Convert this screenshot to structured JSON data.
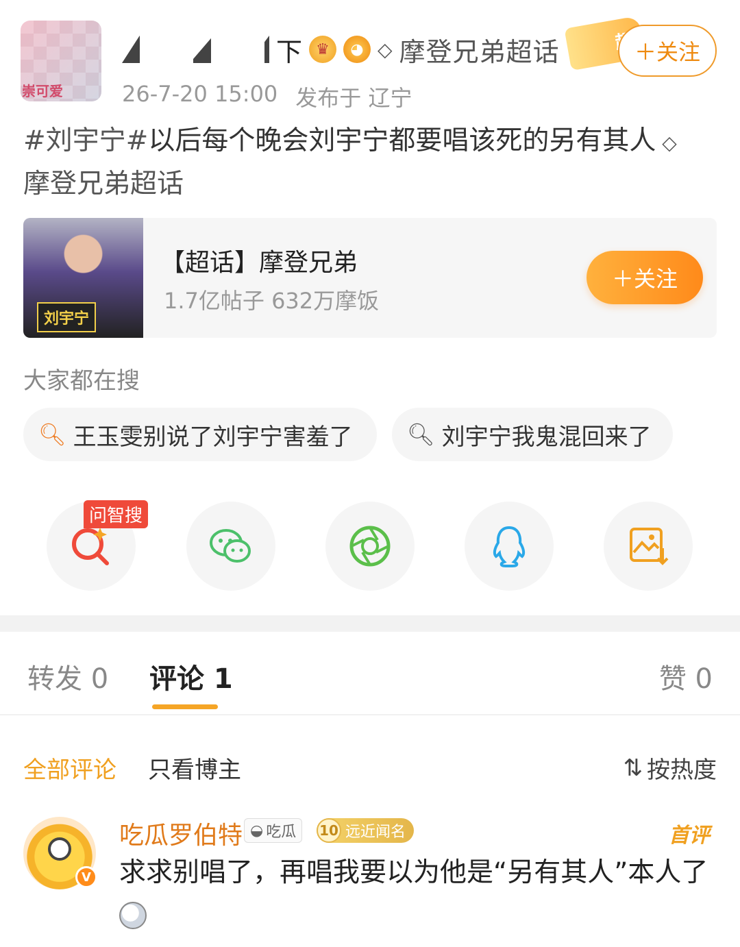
{
  "header": {
    "username_visible": "下",
    "super_topic_link": "摩登兄弟超话",
    "chao_label": "超",
    "follow_label": "＋关注",
    "avatar_tag": "崇可爱",
    "time": "26-7-20 15:00",
    "location": "发布于 辽宁"
  },
  "post": {
    "topic": "#刘宇宁#",
    "text": "以后每个晚会刘宇宁都要唱该死的另有其人",
    "topic_link": "摩登兄弟超话"
  },
  "topic_card": {
    "title": "【超话】摩登兄弟",
    "stats": "1.7亿帖子 632万摩饭",
    "follow_label": "＋关注",
    "image_stamp": "刘宇宁"
  },
  "search": {
    "title": "大家都在搜",
    "items": [
      "王玉雯别说了刘宇宁害羞了",
      "刘宇宁我鬼混回来了"
    ]
  },
  "share": {
    "ai_badge": "问智搜",
    "icons": [
      "ai-search-icon",
      "wechat-icon",
      "moments-icon",
      "qq-icon",
      "save-image-icon"
    ]
  },
  "tabs": {
    "forward": "转发 0",
    "comment": "评论 1",
    "like": "赞 0"
  },
  "filters": {
    "all": "全部评论",
    "owner_only": "只看博主",
    "sort": "按热度"
  },
  "comment": {
    "name": "吃瓜罗伯特",
    "tag1": "吃瓜",
    "level": "10",
    "tag2": "远近闻名",
    "first_label": "首评",
    "text": "求求别唱了，再唱我要以为他是“另有其人”本人了"
  },
  "colors": {
    "accent": "#f0a020",
    "follow_gradient_start": "#ffb13d",
    "follow_gradient_end": "#ff8a1a"
  }
}
